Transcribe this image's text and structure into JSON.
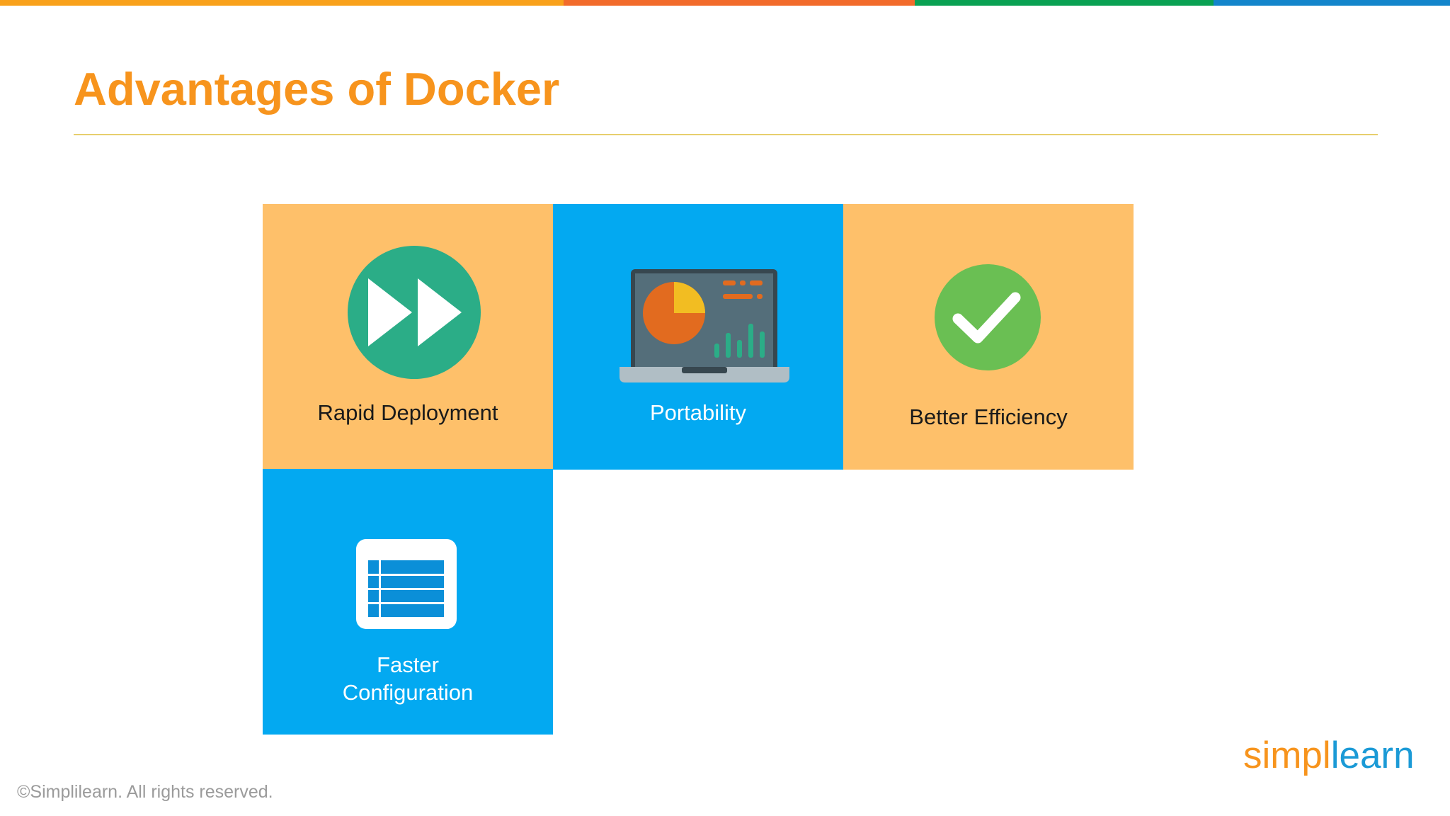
{
  "colors": {
    "title": "#f7941d",
    "tile_orange": "#fec06a",
    "tile_blue": "#03a9f1",
    "topbar": [
      "#f9a11b",
      "#f26b2b",
      "#0aa153",
      "#1385cb"
    ]
  },
  "slide": {
    "title": "Advantages of Docker"
  },
  "tiles": [
    {
      "label": "Rapid Deployment",
      "icon": "fast-forward-icon"
    },
    {
      "label": "Portability",
      "icon": "laptop-dashboard-icon"
    },
    {
      "label": "Better Efficiency",
      "icon": "checkmark-icon"
    },
    {
      "label_line1": "Faster",
      "label_line2": "Configuration",
      "icon": "table-icon"
    }
  ],
  "footer": {
    "copyright": "©Simplilearn. All rights reserved."
  },
  "logo": {
    "part1": "simpl",
    "part2": "learn"
  }
}
